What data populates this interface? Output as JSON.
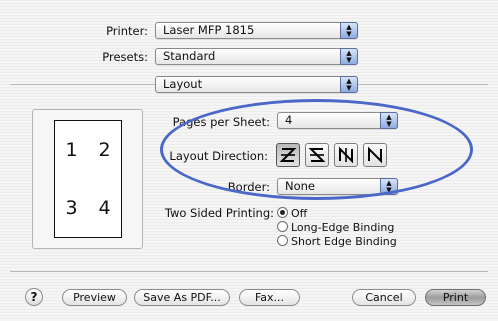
{
  "printer": {
    "label": "Printer:",
    "value": "Laser MFP 1815"
  },
  "presets": {
    "label": "Presets:",
    "value": "Standard"
  },
  "panel": {
    "value": "Layout"
  },
  "preview": {
    "pages": [
      "1",
      "2",
      "3",
      "4"
    ]
  },
  "pages_per_sheet": {
    "label": "Pages per Sheet:",
    "value": "4"
  },
  "layout_direction": {
    "label": "Layout Direction:",
    "options": [
      "z-order-icon",
      "reverse-z-order-icon",
      "n-order-icon",
      "reverse-n-order-icon"
    ],
    "selected": 0
  },
  "border": {
    "label": "Border:",
    "value": "None"
  },
  "two_sided": {
    "label": "Two Sided Printing:",
    "options": [
      "Off",
      "Long-Edge Binding",
      "Short Edge Binding"
    ],
    "selected": 0
  },
  "buttons": {
    "help": "?",
    "preview": "Preview",
    "save_as_pdf": "Save As PDF...",
    "fax": "Fax...",
    "cancel": "Cancel",
    "print": "Print"
  },
  "colors": {
    "highlight_ellipse": "#4b67c9",
    "popup_arrow": "#8fabde"
  }
}
